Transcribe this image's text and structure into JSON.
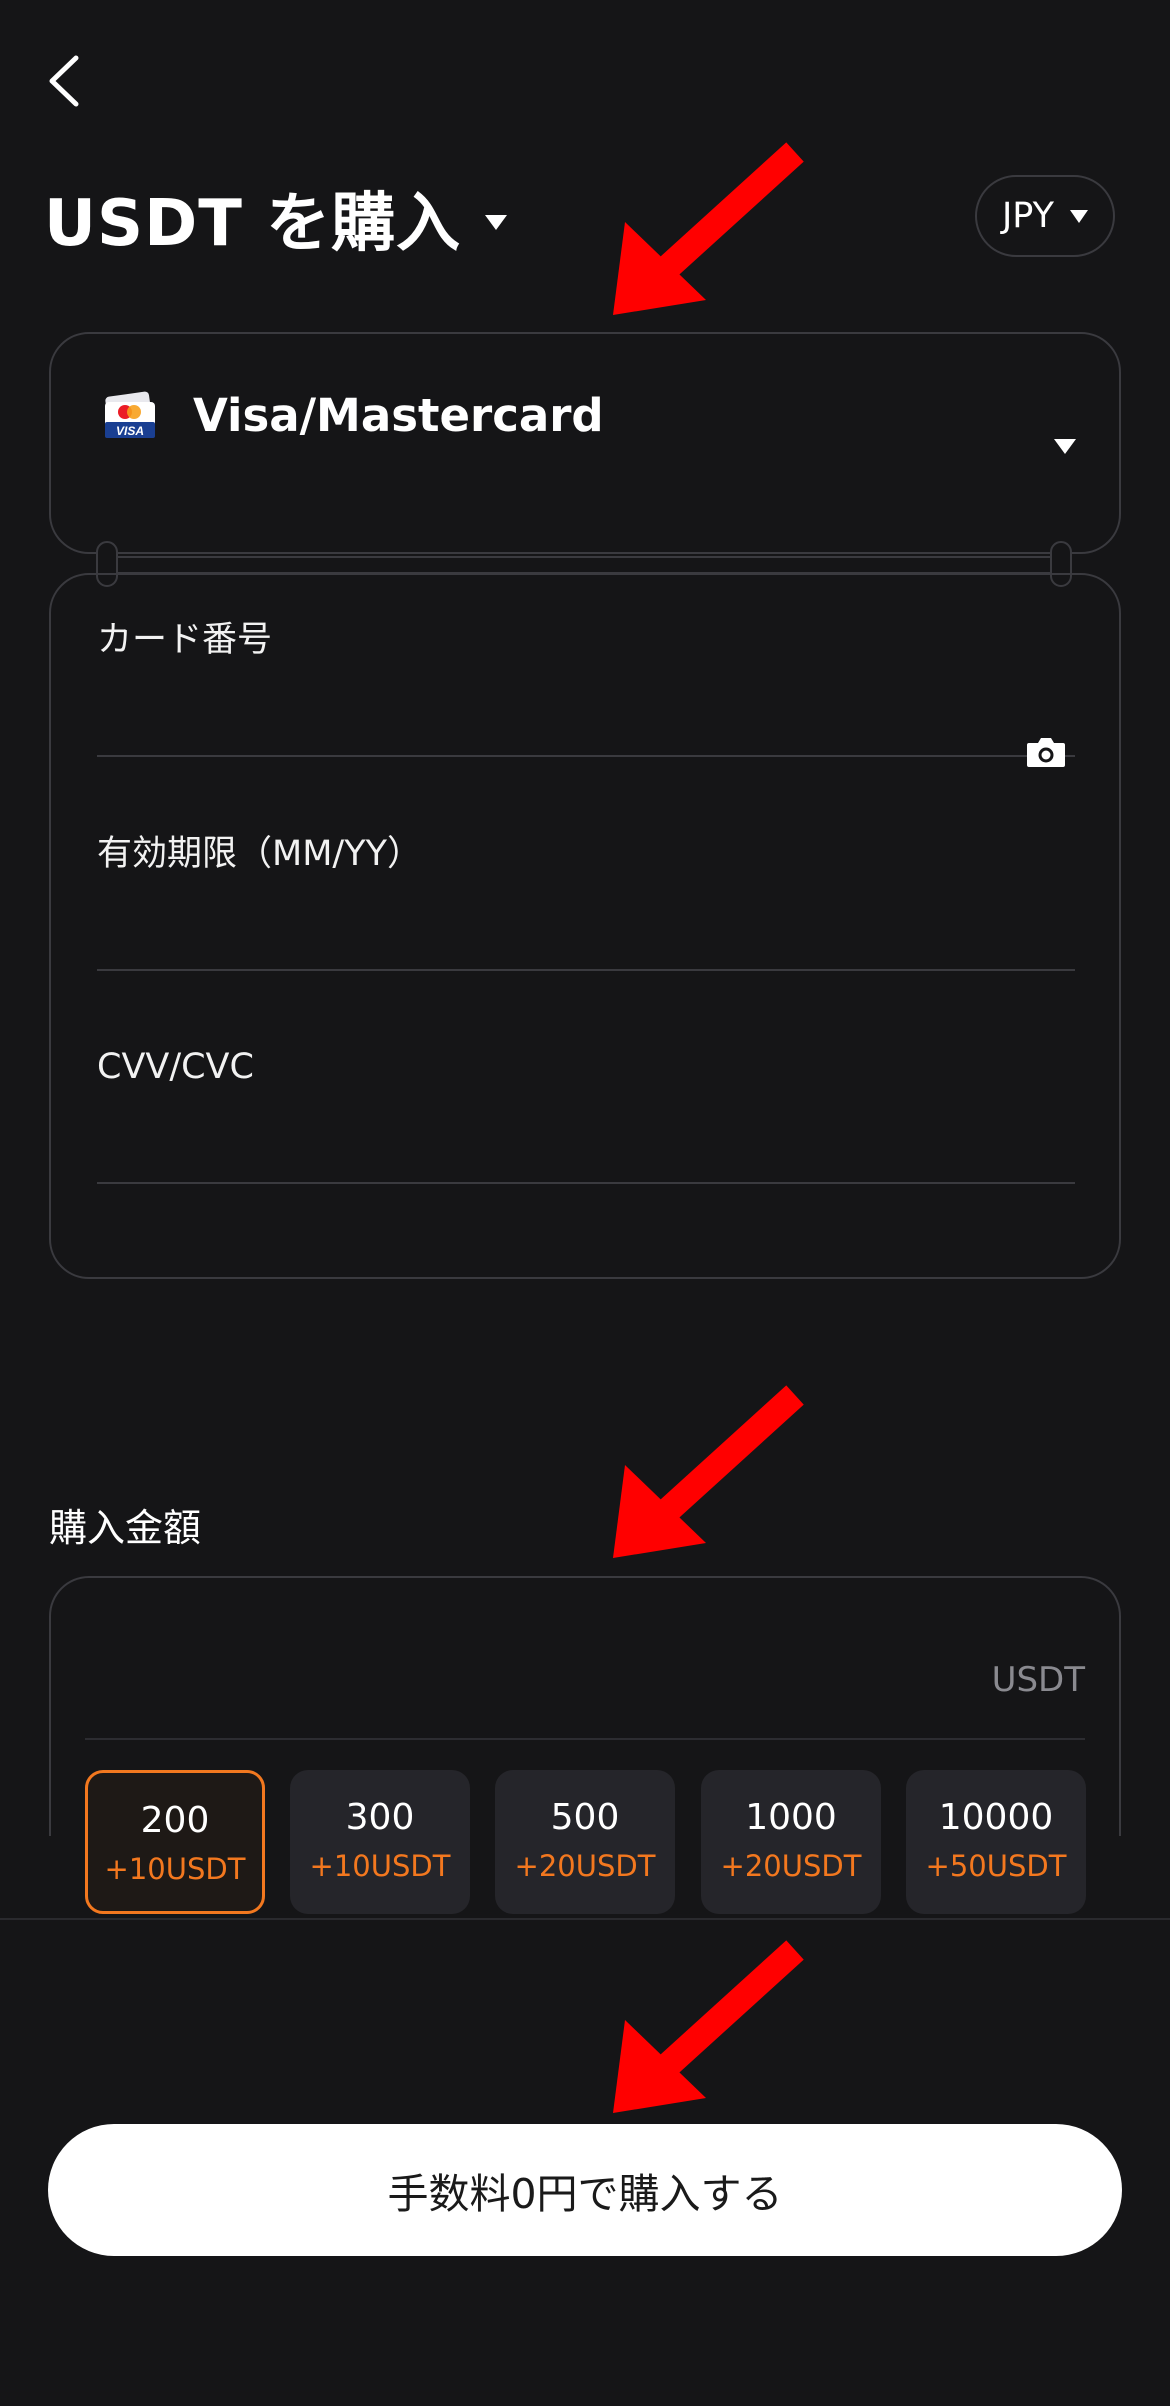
{
  "header": {
    "title": "USDT を購入",
    "currency": "JPY"
  },
  "payment_method": {
    "label": "Visa/Mastercard",
    "icon_text": "VISA"
  },
  "card_form": {
    "card_number_label": "カード番号",
    "expiry_label": "有効期限（MM/YY）",
    "cvv_label": "CVV/CVC"
  },
  "amount": {
    "label": "購入金額",
    "unit": "USDT",
    "presets": [
      {
        "amount": "200",
        "bonus": "+10USDT",
        "selected": true
      },
      {
        "amount": "300",
        "bonus": "+10USDT",
        "selected": false
      },
      {
        "amount": "500",
        "bonus": "+20USDT",
        "selected": false
      },
      {
        "amount": "1000",
        "bonus": "+20USDT",
        "selected": false
      },
      {
        "amount": "10000",
        "bonus": "+50USDT",
        "selected": false
      }
    ]
  },
  "buy_button": {
    "label": "手数料0円で購入する"
  },
  "colors": {
    "background": "#151517",
    "accent": "#f3781f",
    "annotation_arrow": "#ff0000"
  }
}
